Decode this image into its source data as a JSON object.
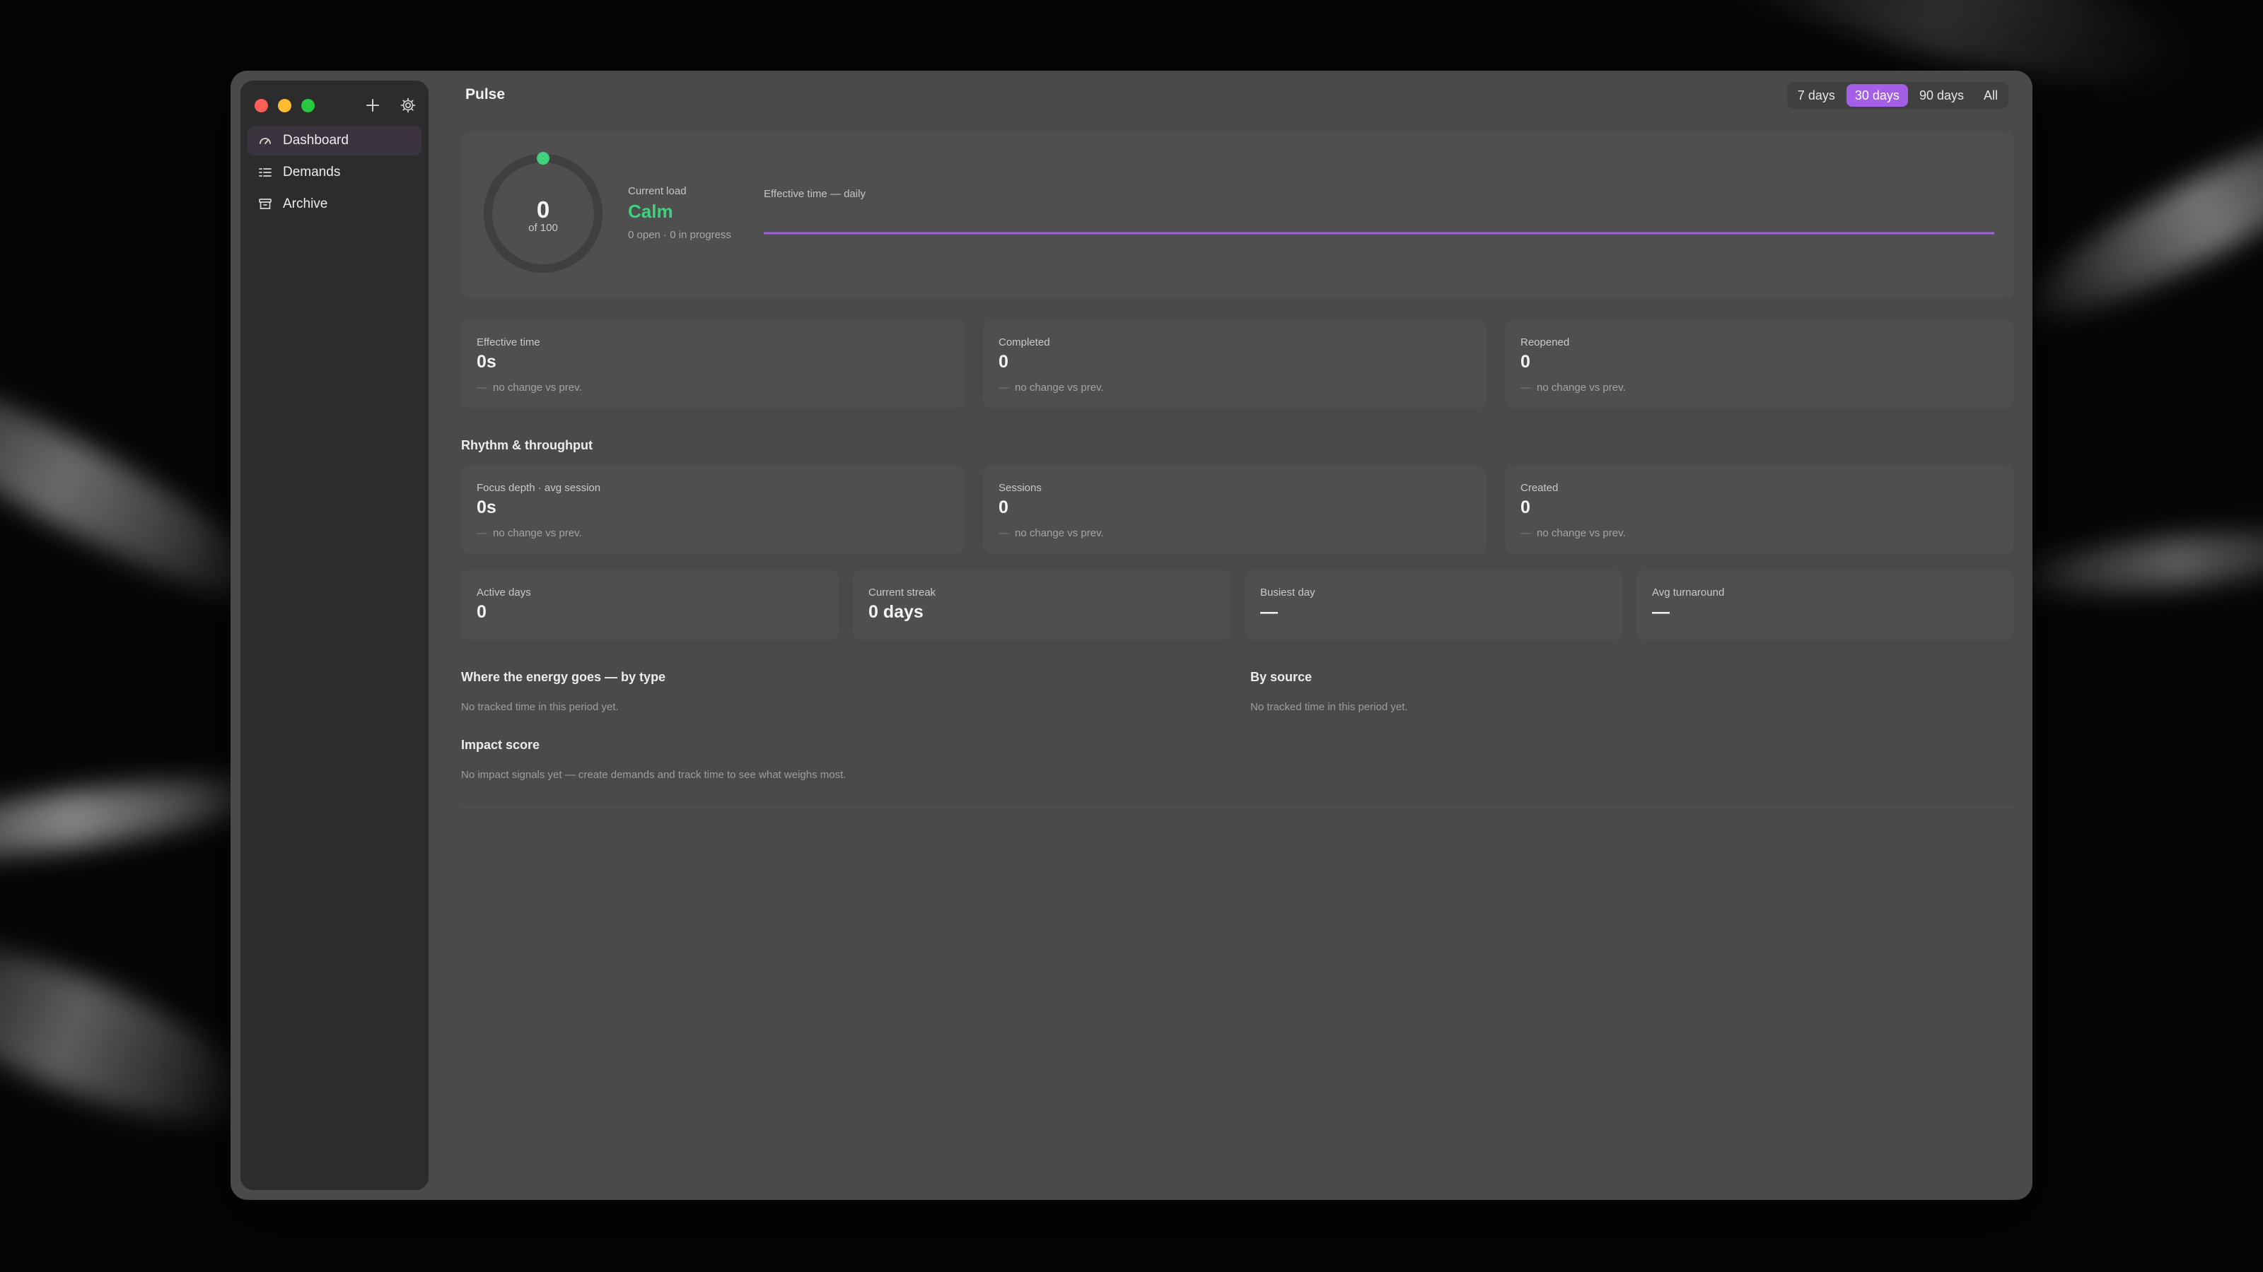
{
  "colors": {
    "accent": "#a35fe6",
    "calm": "#3fd17b",
    "sparkline": "#a35fe6"
  },
  "window": {
    "title": "Pulse"
  },
  "sidebar": {
    "tools": [
      {
        "icon": "plus-icon"
      },
      {
        "icon": "gear-icon"
      }
    ],
    "items": [
      {
        "label": "Dashboard",
        "icon": "gauge-icon",
        "active": true
      },
      {
        "label": "Demands",
        "icon": "list-icon",
        "active": false
      },
      {
        "label": "Archive",
        "icon": "archive-icon",
        "active": false
      }
    ]
  },
  "range": {
    "options": [
      "7 days",
      "30 days",
      "90 days",
      "All"
    ],
    "selected": "30 days"
  },
  "hero": {
    "gauge_value": "0",
    "gauge_max": "of 100",
    "gauge_level": 0,
    "load_label": "Current load",
    "load_status": "Calm",
    "load_meta": "0 open · 0 in progress",
    "spark_label": "Effective time — daily"
  },
  "stats_top": [
    {
      "label": "Effective time",
      "value": "0s",
      "change": "no change vs prev."
    },
    {
      "label": "Completed",
      "value": "0",
      "change": "no change vs prev."
    },
    {
      "label": "Reopened",
      "value": "0",
      "change": "no change vs prev."
    }
  ],
  "rhythm": {
    "title": "Rhythm & throughput",
    "stats": [
      {
        "label": "Focus depth · avg session",
        "value": "0s",
        "change": "no change vs prev."
      },
      {
        "label": "Sessions",
        "value": "0",
        "change": "no change vs prev."
      },
      {
        "label": "Created",
        "value": "0",
        "change": "no change vs prev."
      }
    ],
    "small": [
      {
        "label": "Active days",
        "value": "0"
      },
      {
        "label": "Current streak",
        "value": "0 days"
      },
      {
        "label": "Busiest day",
        "value": "—"
      },
      {
        "label": "Avg turnaround",
        "value": "—"
      }
    ]
  },
  "energy": {
    "title": "Where the energy goes — by type",
    "empty": "No tracked time in this period yet."
  },
  "source": {
    "title": "By source",
    "empty": "No tracked time in this period yet."
  },
  "impact": {
    "title": "Impact score",
    "empty": "No impact signals yet — create demands and track time to see what weighs most."
  }
}
